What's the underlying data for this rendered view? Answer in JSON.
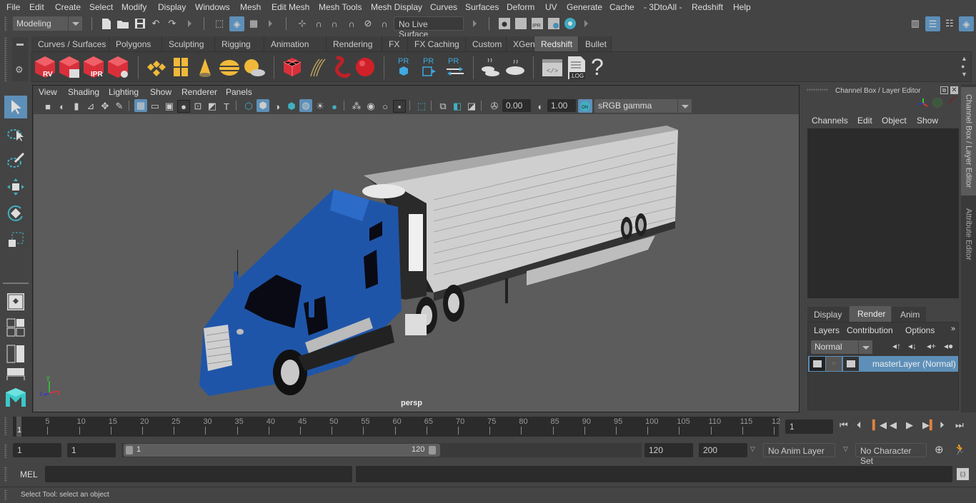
{
  "menubar": {
    "items": [
      "File",
      "Edit",
      "Create",
      "Select",
      "Modify",
      "Display",
      "Windows",
      "Mesh",
      "Edit Mesh",
      "Mesh Tools",
      "Mesh Display",
      "Curves",
      "Surfaces",
      "Deform",
      "UV",
      "Generate",
      "Cache",
      "- 3DtoAll -",
      "Redshift",
      "Help"
    ]
  },
  "statusline": {
    "mode_selector": "Modeling",
    "live_surface": "No Live Surface",
    "icons": [
      "new-scene-icon",
      "open-scene-icon",
      "save-scene-icon",
      "undo-icon",
      "redo-icon",
      "select-hierarchy-icon",
      "select-object-icon",
      "select-component-icon",
      "snap-grid-icon",
      "snap-curve-icon",
      "snap-point-icon",
      "snap-view-plane-icon",
      "snap-surface-icon",
      "make-live-icon",
      "render-view-icon",
      "render-current-frame-icon",
      "ipr-render-icon",
      "render-settings-icon",
      "hypershade-icon"
    ]
  },
  "shelf": {
    "tabs": [
      "Curves / Surfaces",
      "Polygons",
      "Sculpting",
      "Rigging",
      "Animation",
      "Rendering",
      "FX",
      "FX Caching",
      "Custom",
      "XGen",
      "Redshift",
      "Bullet"
    ],
    "active_tab": "Redshift",
    "icons": [
      {
        "name": "redshift-render-view-icon",
        "label": "RV"
      },
      {
        "name": "redshift-batch-render-icon",
        "label": ""
      },
      {
        "name": "redshift-ipr-icon",
        "label": "IPR"
      },
      {
        "name": "redshift-render-settings-icon",
        "label": ""
      },
      {
        "name": "redshift-area-light-icon",
        "label": ""
      },
      {
        "name": "redshift-portal-light-icon",
        "label": ""
      },
      {
        "name": "redshift-physical-light-icon",
        "label": ""
      },
      {
        "name": "redshift-dome-light-icon",
        "label": ""
      },
      {
        "name": "redshift-sun-sky-icon",
        "label": ""
      },
      {
        "name": "redshift-proxy-icon",
        "label": ""
      },
      {
        "name": "redshift-hair-icon",
        "label": ""
      },
      {
        "name": "redshift-volume-icon",
        "label": ""
      },
      {
        "name": "redshift-sphere-icon",
        "label": ""
      },
      {
        "name": "redshift-pr-object-icon",
        "label": "PR"
      },
      {
        "name": "redshift-pr-export-icon",
        "label": "PR"
      },
      {
        "name": "redshift-pr-swap-icon",
        "label": "PR"
      },
      {
        "name": "redshift-bake-multi-icon",
        "label": ""
      },
      {
        "name": "redshift-bake-icon",
        "label": ""
      },
      {
        "name": "redshift-script-icon",
        "label": ""
      },
      {
        "name": "redshift-log-icon",
        "label": ".LOG"
      },
      {
        "name": "redshift-help-icon",
        "label": "?"
      }
    ]
  },
  "viewport": {
    "menus": [
      "View",
      "Shading",
      "Lighting",
      "Show",
      "Renderer",
      "Panels"
    ],
    "exposure": "0.00",
    "gamma": "1.00",
    "color_space": "sRGB gamma",
    "color_management_toggle": "ON",
    "camera_label": "persp",
    "axis_labels": {
      "x": "x",
      "y": "y",
      "z": "z"
    }
  },
  "channel_box": {
    "title": "Channel Box / Layer Editor",
    "menus": [
      "Channels",
      "Edit",
      "Object",
      "Show"
    ]
  },
  "layer_editor": {
    "tabs": [
      "Display",
      "Render",
      "Anim"
    ],
    "active_tab": "Render",
    "menus": [
      "Layers",
      "Contribution",
      "Options"
    ],
    "blend_mode": "Normal",
    "layers": [
      {
        "name": "masterLayer (Normal)",
        "selected": true
      }
    ]
  },
  "side_tabs": [
    "Channel Box / Layer Editor",
    "Attribute Editor"
  ],
  "timeline": {
    "current_frame_marker": "1",
    "ticks": [
      5,
      10,
      15,
      20,
      25,
      30,
      35,
      40,
      45,
      50,
      55,
      60,
      65,
      70,
      75,
      80,
      85,
      90,
      95,
      100,
      105,
      110,
      115,
      "12"
    ],
    "current_frame": "1",
    "playback_buttons": [
      "go-to-start-icon",
      "step-back-frame-icon",
      "step-back-key-icon",
      "play-backward-icon",
      "play-forward-icon",
      "step-forward-key-icon",
      "step-forward-frame-icon",
      "go-to-end-icon"
    ]
  },
  "range": {
    "start": "1",
    "playback_start": "1",
    "slider_start": "1",
    "slider_end": "120",
    "playback_end": "120",
    "end": "200",
    "anim_layer": "No Anim Layer",
    "character_set": "No Character Set"
  },
  "command_line": {
    "language": "MEL",
    "input": "",
    "result": ""
  },
  "help_line": {
    "text": "Select Tool: select an object"
  },
  "colors": {
    "accent": "#5d8fb8",
    "background": "#444444",
    "viewport": "#5c5c5c",
    "truck_blue": "#1f55a8",
    "redshift_red": "#d8303a",
    "light_yellow": "#f0b93a"
  }
}
